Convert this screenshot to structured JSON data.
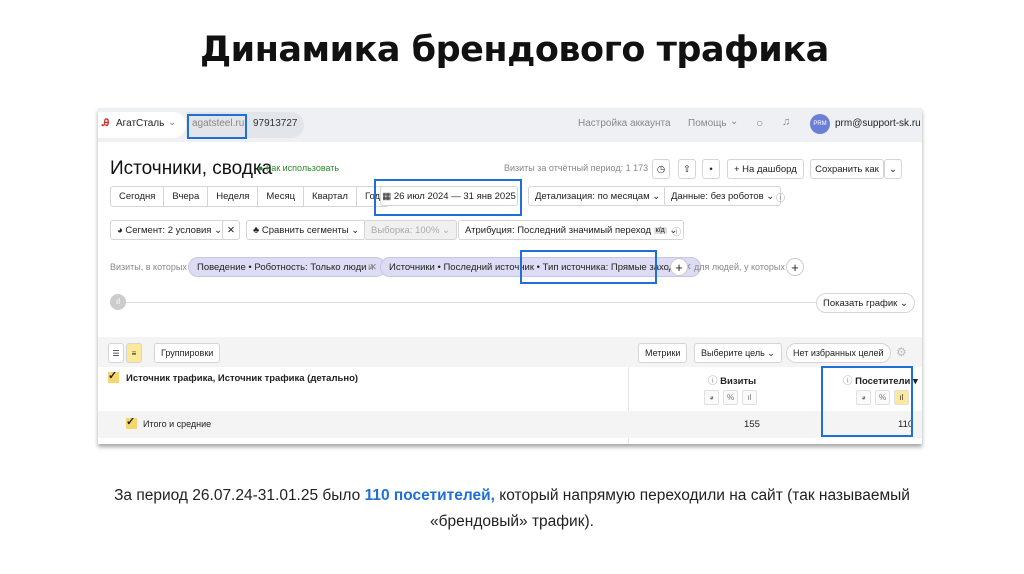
{
  "slide": {
    "title": "Динамика брендового трафика",
    "caption_before": "За период 26.07.24-31.01.25 было ",
    "caption_highlight": "110 посетителей,",
    "caption_after": " который напрямую переходили на сайт (так называемый",
    "caption_line2": "«брендовый» трафик).",
    "accent_color": "#1f6fd6"
  },
  "topbar": {
    "org": "АгатСталь",
    "site": "agatsteel.ru",
    "counter_id": "97913727",
    "account_settings": "Настройка аккаунта",
    "help": "Помощь",
    "user": "prm@support-sk.ru",
    "avatar": "PRM"
  },
  "report": {
    "title": "Источники, сводка",
    "how_to_use": "Как использовать",
    "visits_period": "Визиты за отчётный период: 1 173",
    "to_dashboard": "+ На дашборд",
    "save_as": "Сохранить как",
    "periods": [
      "Сегодня",
      "Вчера",
      "Неделя",
      "Месяц",
      "Квартал",
      "Год"
    ],
    "date_range": "26 июл 2024 — 31 янв 2025",
    "detail": "Детализация: по месяцам",
    "data": "Данные: без роботов",
    "segment": "Сегмент: 2 условия",
    "compare": "Сравнить сегменты",
    "sample": "Выборка: 100%",
    "attribution": "Атрибуция: Последний значимый переход",
    "attribution_badge": "к/д",
    "visits_where": "Визиты, в которых",
    "filter1": "Поведение • Роботность: Только люди",
    "and": "и",
    "filter2": "Источники • Последний источник • Тип источника: Прямые заходы",
    "for_people": "для людей, у которых",
    "show_chart": "Показать график"
  },
  "table": {
    "groupings": "Группировки",
    "metrics": "Метрики",
    "choose_goal": "Выберите цель",
    "no_fav_goals": "Нет избранных целей",
    "dimension": "Источник трафика, Источник трафика (детально)",
    "columns": [
      "Визиты",
      "Посетители"
    ],
    "total_label": "Итого и средние",
    "total_values": [
      "155",
      "110"
    ]
  }
}
